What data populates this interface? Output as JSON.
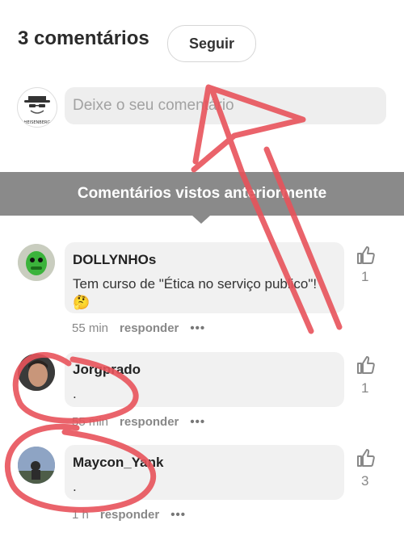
{
  "header": {
    "count_label": "3 comentários",
    "follow_label": "Seguir"
  },
  "composer": {
    "placeholder": "Deixe o seu comentário",
    "avatar_text": "HEISENBERG"
  },
  "banner": {
    "label": "Comentários vistos anteriormente"
  },
  "comments": [
    {
      "author": "DOLLYNHOs",
      "text": "Tem curso de \"Ética no serviço publico\"! 🤔",
      "time": "55 min",
      "reply": "responder",
      "more": "•••",
      "likes": "1"
    },
    {
      "author": "Jorgprado",
      "text": ".",
      "time": "55 min",
      "reply": "responder",
      "more": "•••",
      "likes": "1"
    },
    {
      "author": "Maycon_Yank",
      "text": ".",
      "time": "1 h",
      "reply": "responder",
      "more": "•••",
      "likes": "3"
    }
  ],
  "colors": {
    "annotation": "#e8535b",
    "banner": "#8a8a8a",
    "bubble": "#f1f1f1"
  },
  "icons": {
    "like": "thumbs-up-icon",
    "more": "more-dots-icon"
  }
}
